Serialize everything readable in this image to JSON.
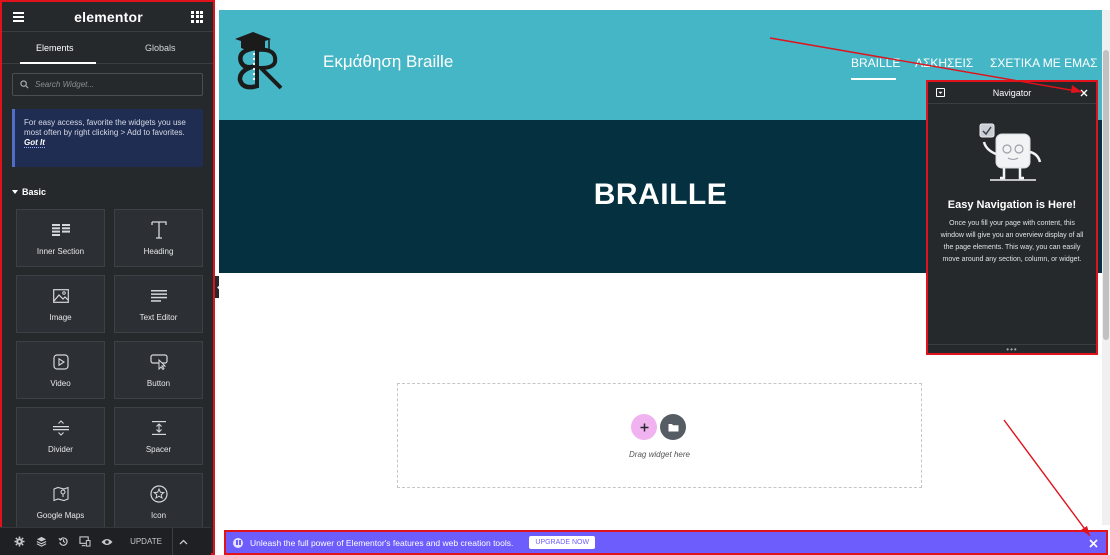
{
  "panel": {
    "logo": "elementor",
    "tabs": [
      {
        "label": "Elements",
        "active": true
      },
      {
        "label": "Globals",
        "active": false
      }
    ],
    "search": {
      "placeholder": "Search Widget..."
    },
    "tip": {
      "text": "For easy access, favorite the widgets you use most often by right clicking > Add to favorites.",
      "link": "Got It"
    },
    "category": "Basic",
    "widgets": [
      {
        "label": "Inner Section",
        "icon": "inner-section-icon"
      },
      {
        "label": "Heading",
        "icon": "heading-icon"
      },
      {
        "label": "Image",
        "icon": "image-icon"
      },
      {
        "label": "Text Editor",
        "icon": "text-editor-icon"
      },
      {
        "label": "Video",
        "icon": "video-icon"
      },
      {
        "label": "Button",
        "icon": "button-icon"
      },
      {
        "label": "Divider",
        "icon": "divider-icon"
      },
      {
        "label": "Spacer",
        "icon": "spacer-icon"
      },
      {
        "label": "Google Maps",
        "icon": "google-maps-icon"
      },
      {
        "label": "Icon",
        "icon": "star-icon"
      }
    ],
    "footer": {
      "icons": [
        "settings-icon",
        "layers-icon",
        "history-icon",
        "responsive-icon",
        "preview-icon"
      ],
      "update_label": "UPDATE"
    }
  },
  "site": {
    "title": "Εκμάθηση Braille",
    "nav": [
      {
        "label": "BRAILLE",
        "active": true
      },
      {
        "label": "ΑΣΚΗΣΕΙΣ",
        "active": false
      },
      {
        "label": "ΣΧΕΤΙΚΑ ΜΕ ΕΜΑΣ",
        "active": false
      }
    ],
    "hero_title": "BRAILLE",
    "drop_text": "Drag widget here"
  },
  "navigator": {
    "title": "Navigator",
    "heading": "Easy Navigation is Here!",
    "body": "Once you fill your page with content, this window will give you an overview display of all the page elements. This way, you can easily move around any section, column, or widget.",
    "dots": "•••"
  },
  "promo": {
    "text": "Unleash the full power of Elementor's features and web creation tools.",
    "button": "UPGRADE NOW"
  },
  "colors": {
    "panel_bg": "#26292c",
    "header_teal": "#45b6c6",
    "hero_dark": "#04303f",
    "promo_purple": "#6d5dfc",
    "annotation_red": "#e0121b",
    "add_button_pink": "#f1b3f0"
  }
}
